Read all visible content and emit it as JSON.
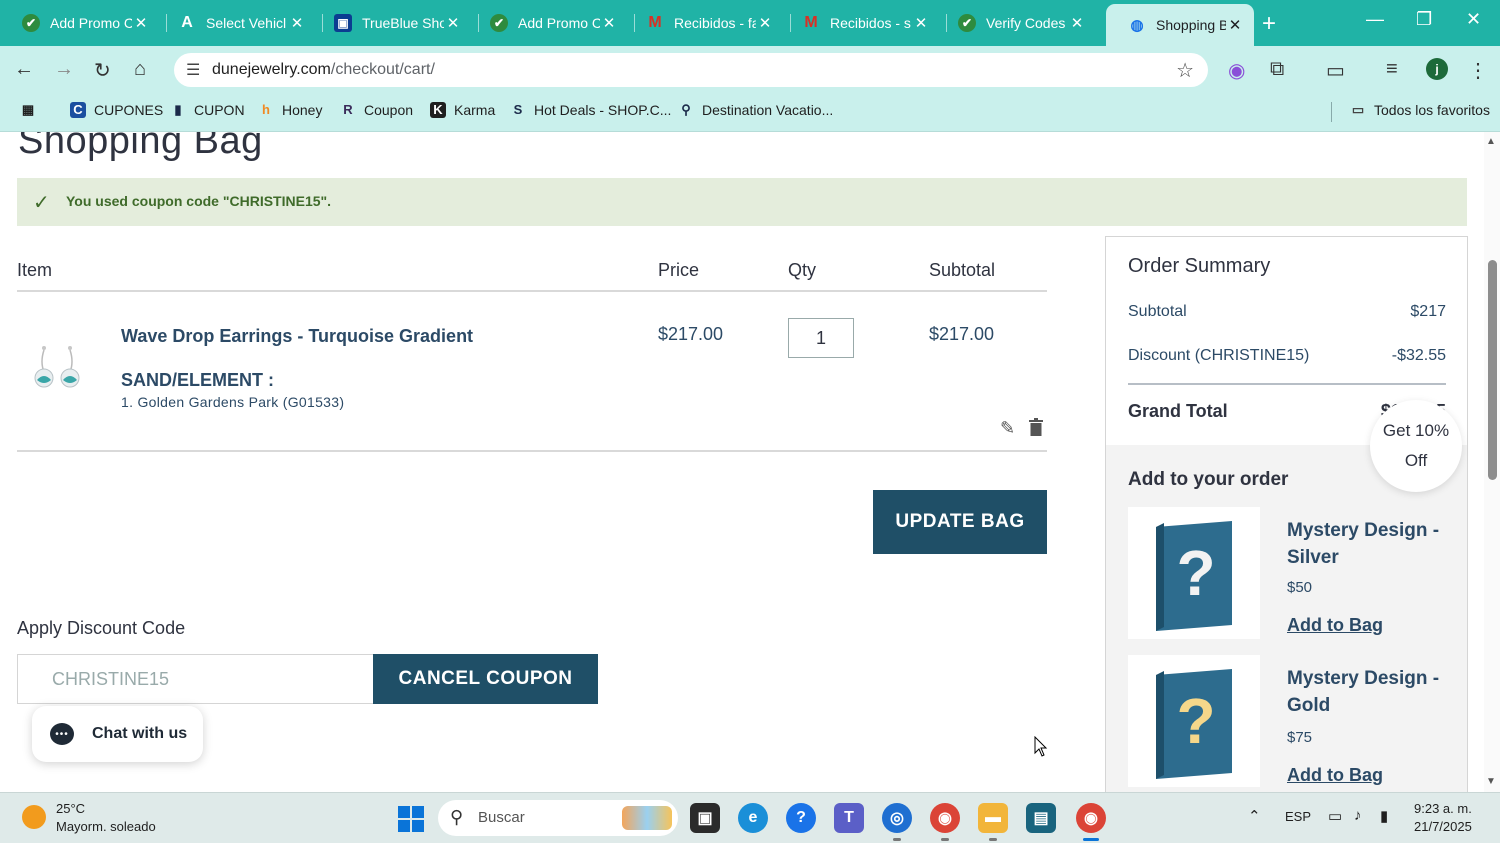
{
  "browser": {
    "tabs": [
      {
        "title": "Add Promo C",
        "icon": "check-circle-icon"
      },
      {
        "title": "Select Vehicl",
        "icon": "a-logo-icon"
      },
      {
        "title": "TrueBlue Sho",
        "icon": "bag-icon"
      },
      {
        "title": "Add Promo C",
        "icon": "check-circle-icon"
      },
      {
        "title": "Recibidos - fa",
        "icon": "gmail-icon"
      },
      {
        "title": "Recibidos - s",
        "icon": "gmail-icon"
      },
      {
        "title": "Verify Codes",
        "icon": "check-circle-icon"
      },
      {
        "title": "Shopping Ba",
        "icon": "globe-icon",
        "active": true
      }
    ],
    "url_domain": "dunejewelry.com",
    "url_path": "/checkout/cart/",
    "profile_initial": "j",
    "bookmarks": [
      {
        "label": "CUPONES",
        "icon": "cupones-icon"
      },
      {
        "label": "CUPON",
        "icon": "bookmark-bag-icon"
      },
      {
        "label": "Honey",
        "icon": "honey-icon"
      },
      {
        "label": "Coupon",
        "icon": "coupon-icon"
      },
      {
        "label": "Karma",
        "icon": "karma-icon"
      },
      {
        "label": "Hot Deals - SHOP.C...",
        "icon": "shop-icon"
      },
      {
        "label": "Destination Vacatio...",
        "icon": "map-pin-icon"
      }
    ],
    "all_bookmarks": "Todos los favoritos",
    "colors": {
      "tabstrip": "#20b3a6",
      "toolbar": "#c9f0ec"
    }
  },
  "page": {
    "title": "Shopping Bag",
    "coupon_message": "You used coupon code \"CHRISTINE15\".",
    "columns": {
      "item": "Item",
      "price": "Price",
      "qty": "Qty",
      "subtotal": "Subtotal"
    },
    "item": {
      "name": "Wave Drop Earrings - Turquoise Gradient",
      "option_label": "SAND/ELEMENT :",
      "option_value": "1. Golden Gardens Park (G01533)",
      "price": "$217.00",
      "qty": "1",
      "subtotal": "$217.00"
    },
    "update_button": "UPDATE BAG",
    "discount": {
      "title": "Apply Discount Code",
      "code_value": "CHRISTINE15",
      "cancel_button": "CANCEL COUPON"
    },
    "chat": {
      "label": "Chat with us"
    },
    "summary": {
      "title": "Order Summary",
      "subtotal_label": "Subtotal",
      "subtotal_value": "$217",
      "discount_label": "Discount (CHRISTINE15)",
      "discount_value": "-$32.55",
      "grand_label": "Grand Total",
      "grand_value": "$184.45"
    },
    "promo_badge": {
      "line1": "Get 10%",
      "line2": "Off"
    },
    "add_to_order": {
      "title": "Add to your order",
      "items": [
        {
          "name": "Mystery Design - Silver",
          "price": "$50",
          "link": "Add to Bag"
        },
        {
          "name": "Mystery Design - Gold",
          "price": "$75",
          "link": "Add to Bag"
        }
      ]
    },
    "colors": {
      "accent": "#1f4f67",
      "coupon_bg": "#e4eddc",
      "coupon_text": "#3f6b2a"
    }
  },
  "taskbar": {
    "weather_temp": "25°C",
    "weather_desc": "Mayorm. soleado",
    "search_placeholder": "Buscar",
    "language": "ESP",
    "time": "9:23 a. m.",
    "date": "21/7/2025"
  }
}
